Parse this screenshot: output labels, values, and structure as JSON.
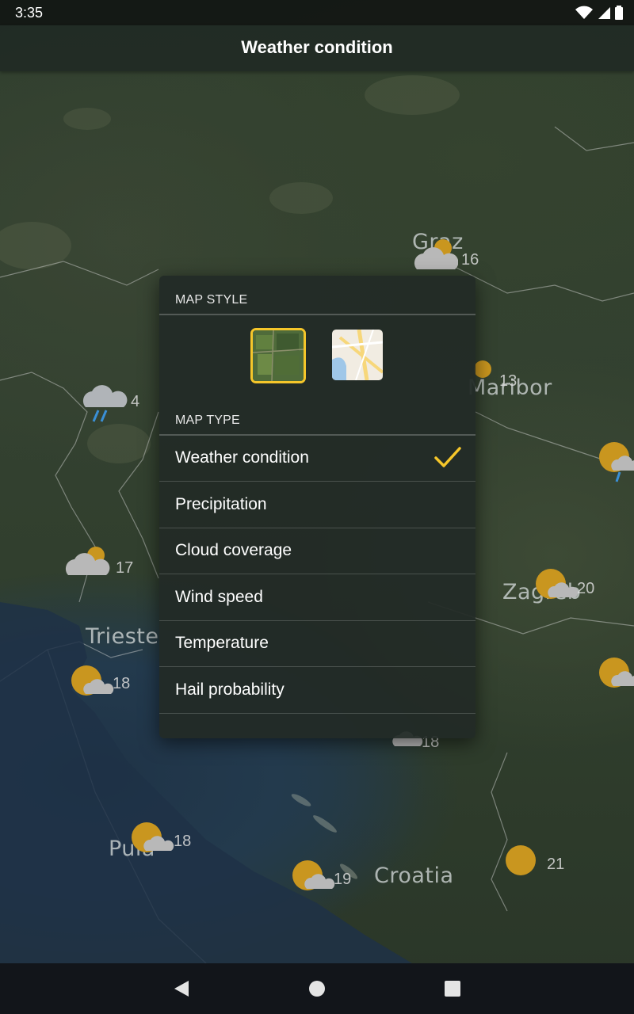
{
  "status_bar": {
    "time": "3:35"
  },
  "app_bar": {
    "title": "Weather condition"
  },
  "map": {
    "cities": [
      "Graz",
      "Maribor",
      "Trieste",
      "Zagreb",
      "Pula",
      "Croatia"
    ],
    "temperatures": [
      "16",
      "13",
      "4",
      "17",
      "20",
      "18",
      "18",
      "18",
      "19",
      "21"
    ]
  },
  "dialog": {
    "map_style_header": "MAP STYLE",
    "map_type_header": "MAP TYPE",
    "styles": [
      "satellite-style",
      "street-style"
    ],
    "selected_style": "satellite-style",
    "map_types": [
      {
        "label": "Weather condition",
        "selected": true
      },
      {
        "label": "Precipitation",
        "selected": false
      },
      {
        "label": "Cloud coverage",
        "selected": false
      },
      {
        "label": "Wind speed",
        "selected": false
      },
      {
        "label": "Temperature",
        "selected": false
      },
      {
        "label": "Hail probability",
        "selected": false
      }
    ],
    "accent_color": "#f5c62a"
  },
  "nav_bar": {
    "icons": [
      "back-icon",
      "home-icon",
      "recents-icon"
    ]
  }
}
